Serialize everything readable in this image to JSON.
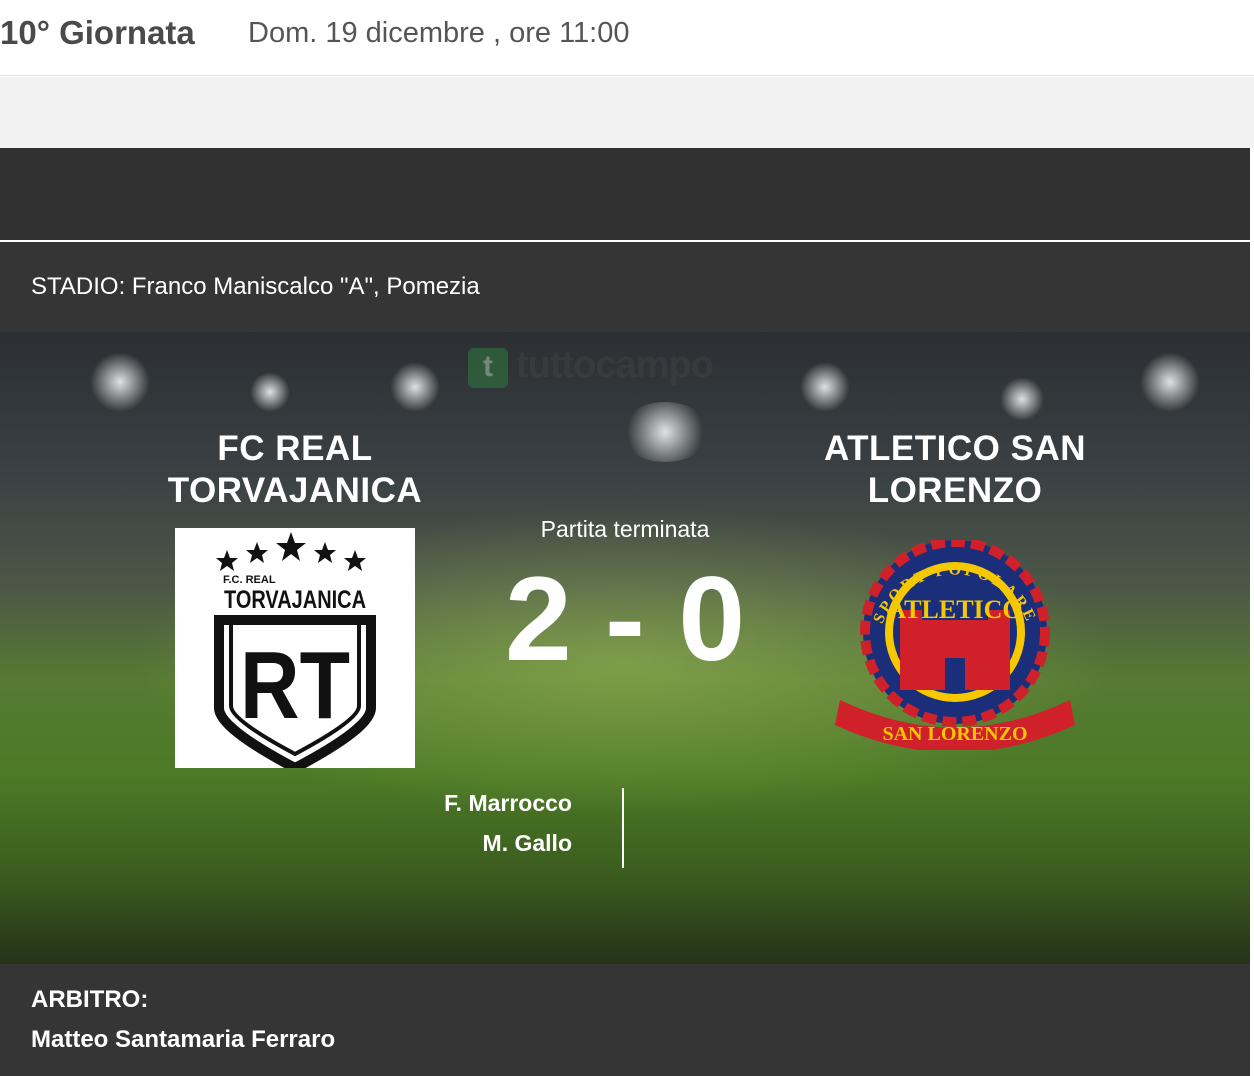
{
  "header": {
    "round": "10° Giornata",
    "date": "Dom. 19 dicembre , ore 11:00"
  },
  "stadium": {
    "text": "STADIO: Franco Maniscalco \"A\", Pomezia"
  },
  "watermark": {
    "text": "tuttocampo",
    "icon": "t"
  },
  "match": {
    "home_team": "FC REAL TORVAJANICA",
    "away_team": "ATLETICO SAN LORENZO",
    "status": "Partita terminata",
    "score": "2 - 0",
    "home_scorers": [
      "F. Marrocco",
      "M. Gallo"
    ]
  },
  "home_logo": {
    "icon": "fc-real-torvajanica-crest",
    "line1": "F.C. REAL",
    "line2": "TORVAJANICA",
    "monogram": "RT"
  },
  "away_logo": {
    "icon": "atletico-san-lorenzo-crest",
    "top_arc": "SPORT POPOLARE",
    "name": "ATLETICO",
    "banner": "SAN LORENZO"
  },
  "referee": {
    "label": "ARBITRO:",
    "name": "Matteo Santamaria Ferraro"
  },
  "colors": {
    "dark": "#353535",
    "white": "#ffffff",
    "pitch_green": "#4c7a26",
    "crest_red": "#d0202a",
    "crest_blue": "#1b2e7a",
    "crest_yellow": "#f5c800"
  }
}
